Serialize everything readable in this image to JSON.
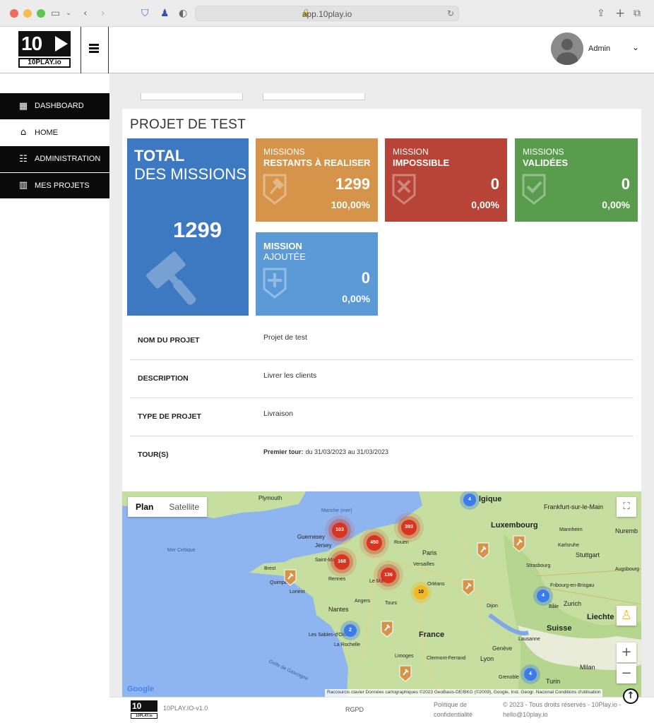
{
  "browser": {
    "url": "app.10play.io",
    "colors": {
      "close": "#ed6a5e",
      "minimize": "#f5bf4f",
      "zoom": "#61c554"
    }
  },
  "header": {
    "logo_mark": "10",
    "logo_text": "10PLAY.io",
    "user_name": "Admin"
  },
  "sidebar": {
    "items": [
      {
        "label": "DASHBOARD",
        "icon": "grid-icon"
      },
      {
        "label": "HOME",
        "icon": "house-icon"
      },
      {
        "label": "ADMINISTRATION",
        "icon": "sliders-icon"
      },
      {
        "label": "MES PROJETS",
        "icon": "chart-icon"
      }
    ]
  },
  "project": {
    "title": "PROJET DE TEST",
    "tiles": {
      "total": {
        "line1": "TOTAL",
        "line2": "DES MISSIONS",
        "value": "1299",
        "color": "#3c79c1"
      },
      "remaining": {
        "line1": "MISSIONS",
        "line2": "RESTANTS À REALISER",
        "value": "1299",
        "percent": "100,00%",
        "color": "#d6944a"
      },
      "impossible": {
        "line1": "MISSION",
        "line2": "IMPOSSIBLE",
        "value": "0",
        "percent": "0,00%",
        "color": "#b74436"
      },
      "validated": {
        "line1": "MISSIONS",
        "line2": "VALIDÉES",
        "value": "0",
        "percent": "0,00%",
        "color": "#5a9c4e"
      },
      "added": {
        "line1": "MISSION",
        "line2": "AJOUTÉE",
        "value": "0",
        "percent": "0,00%",
        "color": "#5b9ad7"
      }
    },
    "details": {
      "name_label": "NOM DU PROJET",
      "name_value": "Projet de test",
      "description_label": "DESCRIPTION",
      "description_value": "Livrer les clients",
      "type_label": "TYPE DE PROJET",
      "type_value": "Livraison",
      "tours_label": "TOUR(S)",
      "tour_prefix": "Premier tour:",
      "tour_dates": "du 31/03/2023 au 31/03/2023"
    }
  },
  "map": {
    "tab_plan": "Plan",
    "tab_satellite": "Satellite",
    "clusters": [
      "103",
      "393",
      "450",
      "168",
      "136",
      "10",
      "4",
      "4",
      "2",
      "4"
    ],
    "places": {
      "plymouth": "Plymouth",
      "manche": "Manche (mer)",
      "guernesey": "Guernesey",
      "jersey": "Jersey",
      "merceltique": "Mer Celtique",
      "saintmalo": "Saint-Malo",
      "rouen": "Rouen",
      "paris": "Paris",
      "versailles": "Versailles",
      "brest": "Brest",
      "quimper": "Quimper",
      "lorient": "Lorient",
      "rennes": "Rennes",
      "lemans": "Le Mans",
      "angers": "Angers",
      "tours": "Tours",
      "nantes": "Nantes",
      "orleans": "Orléans",
      "dijon": "Dijon",
      "france": "France",
      "lessables": "Les Sables-d'Olonne",
      "larochelle": "La Rochelle",
      "golfe": "Golfe de Gascogne",
      "limoges": "Limoges",
      "clermont": "Clermont-Ferrand",
      "lyon": "Lyon",
      "geneve": "Genève",
      "grenoble": "Grenoble",
      "turin": "Turin",
      "milan": "Milan",
      "suisse": "Suisse",
      "zurich": "Zurich",
      "bale": "Bâle",
      "lausanne": "Lausanne",
      "luxembourg": "Luxembourg",
      "belgique": "lgique",
      "frankfurt": "Frankfurt-sur-le-Main",
      "mannheim": "Mannheim",
      "nuremb": "Nuremb",
      "karlsruhe": "Karlsruhe",
      "stuttgart": "Stuttgart",
      "strasbourg": "Strasbourg",
      "augsbourg": "Augsbourg",
      "fribourg": "Fribourg-en-Brisgau",
      "liechte": "Liechte"
    },
    "google": "Google",
    "attribution": "Raccourcis clavier   Données cartographiques ©2023 GeoBasis-DE/BKG (©2009), Google, Inst. Geogr. Nacional   Conditions d'utilisation"
  },
  "footer": {
    "logo_mark": "10",
    "logo_text": "10PLAY.io",
    "version": "10PLAY.IO-v1.0",
    "rgpd": "RGPD",
    "privacy_1": "Politique de",
    "privacy_2": "confidentialité",
    "copyright": "© 2023 - Tous droits réservés - 10Play.io -",
    "email": "hello@10play.io"
  }
}
